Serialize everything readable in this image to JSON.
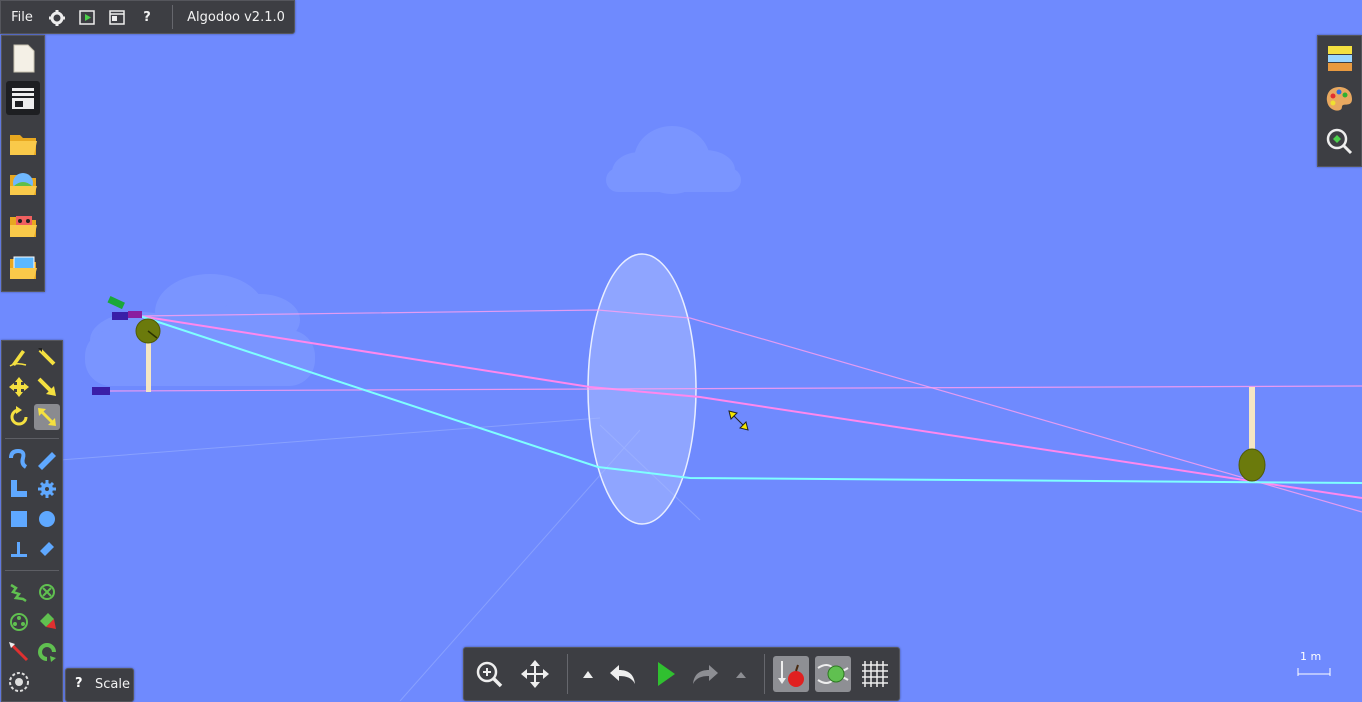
{
  "app": {
    "file_menu": "File",
    "version": "Algodoo v2.1.0"
  },
  "menubar": {
    "icons": [
      "gear-icon",
      "play-window-icon",
      "window-icon",
      "help-icon"
    ],
    "help_glyph": "?"
  },
  "file_toolbar": {
    "items": [
      "new-scene-icon",
      "templates-icon",
      "open-folder-icon",
      "open-world-icon",
      "open-scenes-folder-icon",
      "open-images-folder-icon"
    ]
  },
  "right_toolbar": {
    "items": [
      "background-layers-icon",
      "color-palette-icon",
      "zoom-to-fit-icon"
    ]
  },
  "toolbox": {
    "groups": [
      [
        "sketch-tool-icon",
        "cut-tool-icon",
        "move-tool-icon",
        "drag-tool-icon",
        "rotate-tool-icon",
        "scale-tool-icon"
      ],
      [
        "rope-tool-icon",
        "plane-tool-icon",
        "polygon-tool-icon",
        "gear-tool-icon",
        "box-tool-icon",
        "circle-tool-icon",
        "fixate-tool-icon",
        "hinge-tool-icon"
      ],
      [
        "spring-tool-icon",
        "axle-tool-icon",
        "chain-tool-icon",
        "thruster-tool-icon",
        "laser-tool-icon",
        "tracer-tool-icon",
        "texture-tool-icon"
      ]
    ],
    "selected": "scale-tool-icon"
  },
  "scale_tooltip": {
    "help_glyph": "?",
    "label": "Scale"
  },
  "bottom_bar": {
    "items": [
      "zoom-icon",
      "pan-icon",
      "speed-up-icon",
      "undo-icon",
      "play-icon",
      "redo-icon",
      "options-up-icon",
      "gravity-toggle-icon",
      "air-friction-toggle-icon",
      "grid-toggle-icon"
    ]
  },
  "scene": {
    "scale_label": "1 m",
    "colors": {
      "sky": "#6f8afe",
      "laser_pink": "#ff88ee",
      "laser_cyan": "#7fffff",
      "lens_fill": "#a9bcff",
      "olive": "#6b7a0c",
      "stick": "#f4e6c4"
    }
  }
}
